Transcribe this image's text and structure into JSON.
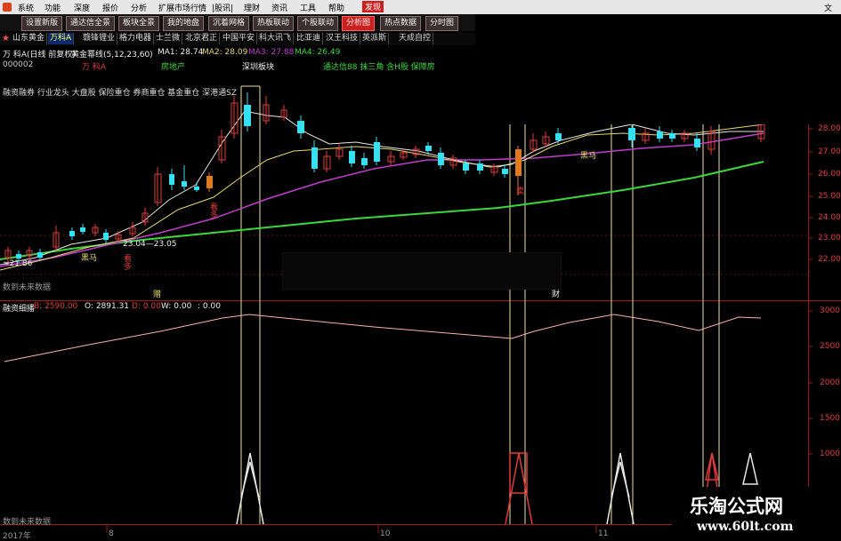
{
  "menu": {
    "items": [
      "系统",
      "功能",
      "深度",
      "报价",
      "分析",
      "扩展市场行情",
      "|股讯|",
      "理财",
      "资讯",
      "工具",
      "帮助"
    ],
    "highlight": "发现",
    "edge_text": "文"
  },
  "tabs": [
    "设置新版",
    "通达信全景",
    "板块全景",
    "我的地盘",
    "沉着网格",
    "热板联动",
    "个股联动",
    "分析图",
    "热点数据",
    "分时图"
  ],
  "active_tab": "分析图",
  "stocks": [
    "山东黄金",
    "万科A",
    "赣锋锂业",
    "格力电器",
    "士兰微",
    "北京君正",
    "中国平安",
    "科大讯飞",
    "比亚迪",
    "汉王科技",
    "英派斯",
    "天成自控"
  ],
  "active_stock": "万科A",
  "header": {
    "name_period": "万 科A(日线 前复权)",
    "indicator": "黄金幂线(5,12,23,60)",
    "ma1": "MA1: 28.74",
    "ma2": "MA2: 28.09",
    "ma3": "MA3: 27.88",
    "ma4": "MA4: 26.49",
    "code": "000002",
    "name_short": "万 科A",
    "industry": "房地产",
    "region": "深圳板块",
    "concepts": "通达信88 抹三角 含H股 保障房",
    "tags": "融资融券 行业龙头 大盘股 保险重仓 券商重仓 基金重仓 深港通SZ"
  },
  "price_axis": [
    "28.00",
    "27.00",
    "26.00",
    "25.00",
    "24.00",
    "23.00",
    "22.00"
  ],
  "price_labels": {
    "low": "=21.86",
    "range": "23.04—23.05",
    "black_horse_1": "黑马",
    "black_horse_2": "黑马",
    "buy_1": "看多",
    "buy_2": "看多",
    "sell": "卖",
    "future_1": "数到未来数据",
    "mark_1": "赠",
    "mark_2": "财"
  },
  "sub_indicator": {
    "name": "融资细播",
    "v1": "B: 2590.00",
    "v2": "O: 2891.31",
    "v3": "D: 0.00",
    "v4": "W: 0.00",
    "v5": ": 0.00"
  },
  "sub_axis": [
    "3000",
    "2500",
    "2000",
    "1500",
    "1000"
  ],
  "bottom": {
    "future_2": "数到未来数据",
    "year": "2017年",
    "t1": "8",
    "t2": "10",
    "t3": "11"
  },
  "watermark": {
    "title": "乐淘公式网",
    "url": "www.60lt.com"
  },
  "colors": {
    "up": "#e23b3b",
    "down": "#35e0f0",
    "ma_white": "#e8e8e8",
    "ma_yellow": "#e8d86a",
    "ma_purple": "#c23cd0",
    "ma_green": "#3ad83a",
    "sub_line": "#ffb0b0",
    "axis_red": "#a01818"
  }
}
